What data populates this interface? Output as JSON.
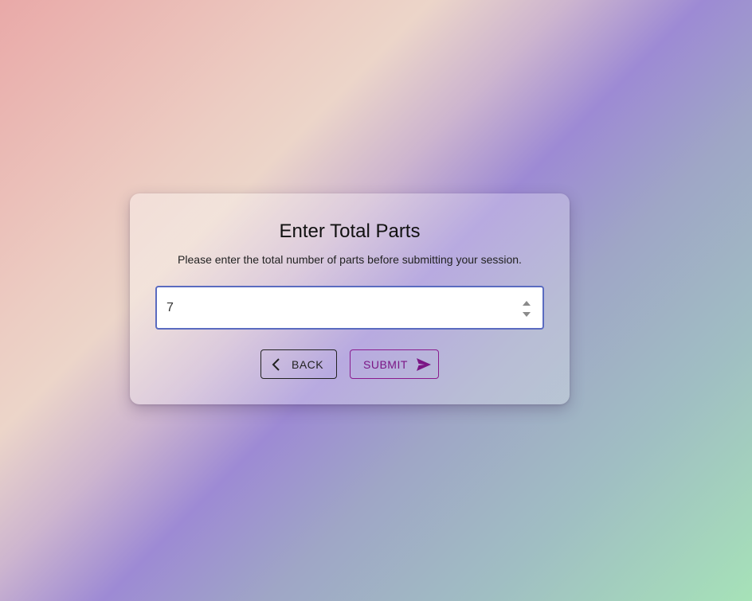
{
  "dialog": {
    "title": "Enter Total Parts",
    "subtitle": "Please enter the total number of parts before submitting your session."
  },
  "total_parts_input": {
    "value": "7",
    "type": "number"
  },
  "buttons": {
    "back_label": "BACK",
    "back_icon": "chevron-left-icon",
    "submit_label": "SUBMIT",
    "submit_icon": "send-icon"
  },
  "colors": {
    "accent_purple": "#7b1685",
    "input_focus_border": "#5a6bc0"
  }
}
